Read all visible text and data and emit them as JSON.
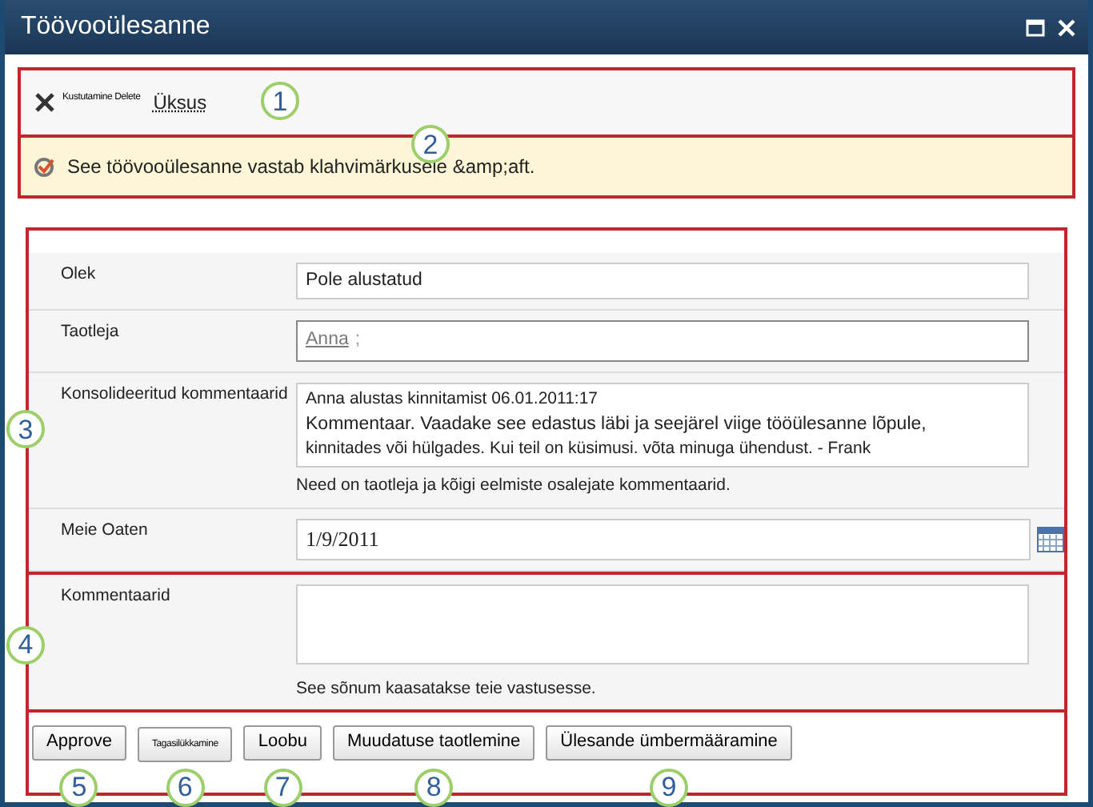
{
  "window": {
    "title": "Töövooülesanne"
  },
  "toolbar": {
    "delete_label": "Kustutamine Delete",
    "item_link": "Üksus",
    "callout": "1"
  },
  "message": {
    "text": "See töövooülesanne vastab klahvimärkusele &amp;aft.",
    "callout": "2"
  },
  "form": {
    "callout": "3",
    "fields": [
      {
        "kind": "text",
        "label": "Olek",
        "value": "Pole alustatud"
      },
      {
        "kind": "people",
        "label": "Taotleja",
        "value": "Anna",
        "separator": ";"
      },
      {
        "kind": "comments",
        "label": "Konsolideeritud kommentaarid",
        "lines": [
          "Anna alustas kinnitamist 06.01.2011:17",
          "Kommentaar. Vaadake see edastus läbi ja seejärel viige tööülesanne lõpule,",
          "kinnitades või hülgades. Kui teil on küsimusi. võta minuga ühendust. - Frank"
        ],
        "note": "Need on taotleja ja kõigi eelmiste osalejate kommentaarid."
      },
      {
        "kind": "date",
        "label": "Meie Oaten",
        "value": "1/9/2011"
      }
    ]
  },
  "comment_section": {
    "callout": "4",
    "label": "Kommentaarid",
    "note": "See sõnum kaasatakse teie vastusesse."
  },
  "buttons": [
    {
      "label": "Approve",
      "kind": "normal",
      "callout": "5"
    },
    {
      "label": "Tagasilükkamine",
      "kind": "tiny",
      "callout": "6"
    },
    {
      "label": "Loobu",
      "kind": "normal",
      "callout": "7"
    },
    {
      "label": "Muudatuse taotlemine",
      "kind": "normal",
      "callout": "8"
    },
    {
      "label": "Ülesande ümbermääramine",
      "kind": "normal",
      "callout": "9"
    }
  ]
}
